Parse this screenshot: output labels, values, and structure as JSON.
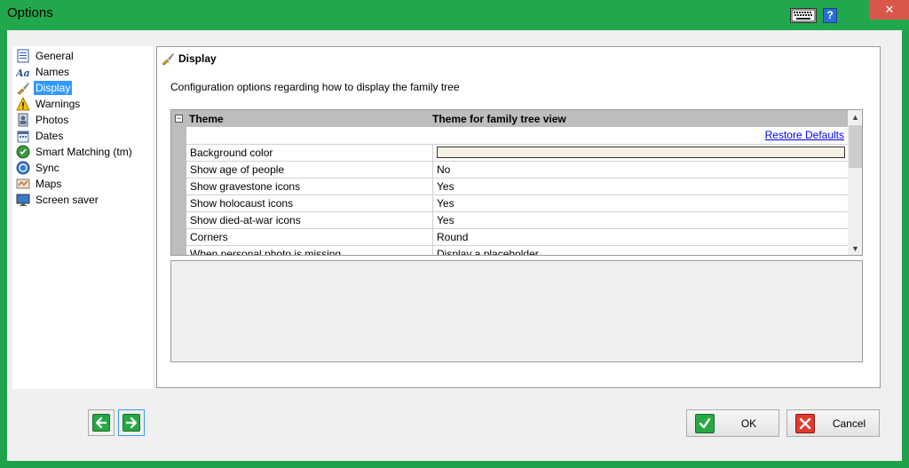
{
  "window": {
    "title": "Options",
    "close_glyph": "✕",
    "help_glyph": "?",
    "keyboard_icon": "keyboard-icon"
  },
  "sidebar": {
    "items": [
      {
        "label": "General",
        "icon": "general-icon",
        "selected": false
      },
      {
        "label": "Names",
        "icon": "names-icon",
        "selected": false
      },
      {
        "label": "Display",
        "icon": "brush-icon",
        "selected": true
      },
      {
        "label": "Warnings",
        "icon": "warning-icon",
        "selected": false
      },
      {
        "label": "Photos",
        "icon": "photo-icon",
        "selected": false
      },
      {
        "label": "Dates",
        "icon": "calendar-icon",
        "selected": false
      },
      {
        "label": "Smart Matching (tm)",
        "icon": "smart-matching-icon",
        "selected": false
      },
      {
        "label": "Sync",
        "icon": "sync-icon",
        "selected": false
      },
      {
        "label": "Maps",
        "icon": "map-icon",
        "selected": false
      },
      {
        "label": "Screen saver",
        "icon": "screen-saver-icon",
        "selected": false
      }
    ]
  },
  "panel": {
    "title": "Display",
    "description": "Configuration options regarding how to display the family tree",
    "grid": {
      "category_name": "Theme",
      "category_value": "Theme for family tree view",
      "restore_label": "Restore Defaults",
      "rows": [
        {
          "name": "Background color",
          "value": "",
          "is_color": true
        },
        {
          "name": "Show age of people",
          "value": "No"
        },
        {
          "name": "Show gravestone icons",
          "value": "Yes"
        },
        {
          "name": "Show holocaust icons",
          "value": "Yes"
        },
        {
          "name": "Show died-at-war icons",
          "value": "Yes"
        },
        {
          "name": "Corners",
          "value": "Round"
        },
        {
          "name": "When personal photo is missing",
          "value": "Display a placeholder"
        }
      ]
    }
  },
  "buttons": {
    "ok": "OK",
    "cancel": "Cancel"
  },
  "colors": {
    "frame": "#22a84c",
    "selection": "#3399ff",
    "background_color_value": "#f5f0e4"
  }
}
